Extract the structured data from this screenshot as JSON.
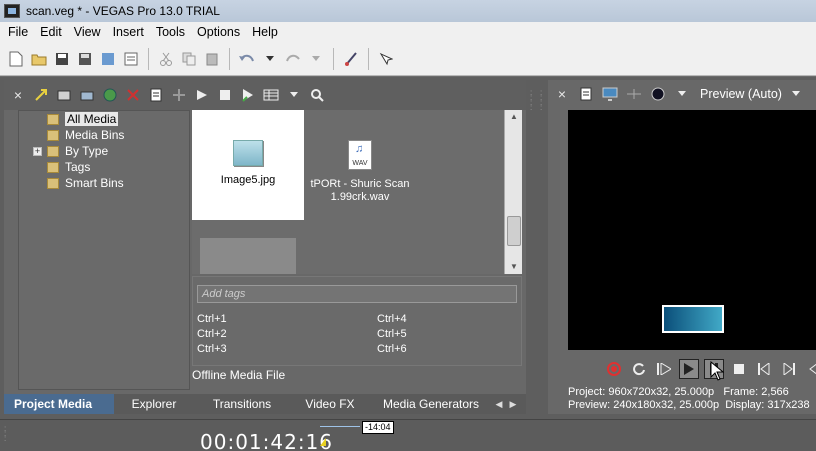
{
  "window": {
    "title": "scan.veg * - VEGAS Pro 13.0 TRIAL"
  },
  "menu": [
    "File",
    "Edit",
    "View",
    "Insert",
    "Tools",
    "Options",
    "Help"
  ],
  "media": {
    "tree": {
      "root": "All Media",
      "items": [
        "Media Bins",
        "By Type",
        "Tags",
        "Smart Bins"
      ],
      "expander": "+"
    },
    "files": [
      {
        "name": "Image5.jpg",
        "icon": "image-file-icon"
      },
      {
        "name": "tPORt - Shuric Scan 1.99crk.wav",
        "icon": "wav-file-icon",
        "icon_label": "WAV"
      }
    ],
    "tags_placeholder": "Add tags",
    "shortcuts": [
      "Ctrl+1",
      "Ctrl+2",
      "Ctrl+3",
      "Ctrl+4",
      "Ctrl+5",
      "Ctrl+6"
    ],
    "status": "Offline Media File"
  },
  "tabs": [
    "Project Media",
    "Explorer",
    "Transitions",
    "Video FX",
    "Media Generators"
  ],
  "preview": {
    "mode": "Preview (Auto)",
    "info": {
      "project_label": "Project:",
      "project_value": "960x720x32, 25.000p",
      "frame_label": "Frame:",
      "frame_value": "2,566",
      "preview_label": "Preview:",
      "preview_value": "240x180x32, 25.000p",
      "display_label": "Display:",
      "display_value": "317x238"
    }
  },
  "timeline": {
    "timecode": "00:01:42:16",
    "marker": "-14:04"
  }
}
